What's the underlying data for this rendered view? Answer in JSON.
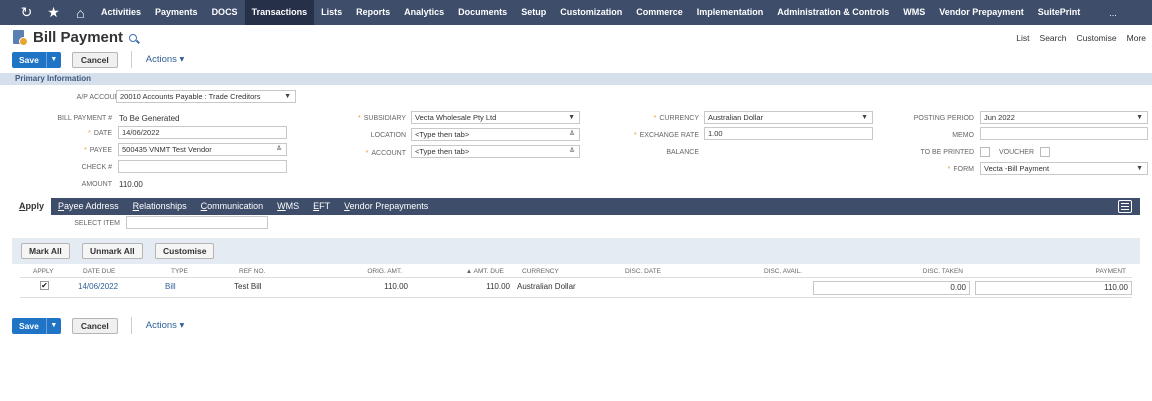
{
  "nav": {
    "items": [
      "Activities",
      "Payments",
      "DOCS",
      "Transactions",
      "Lists",
      "Reports",
      "Analytics",
      "Documents",
      "Setup",
      "Customization",
      "Commerce",
      "Implementation",
      "Administration & Controls",
      "WMS",
      "Vendor Prepayment",
      "SuitePrint"
    ],
    "active": "Transactions",
    "more": "..."
  },
  "header": {
    "title": "Bill Payment",
    "links": [
      "List",
      "Search",
      "Customise",
      "More"
    ]
  },
  "toolbar": {
    "save_label": "Save",
    "arrow": "▼",
    "cancel_label": "Cancel",
    "actions_label": "Actions ▾"
  },
  "section": {
    "title": "Primary Information"
  },
  "form": {
    "ap_account_label": "A/P ACCOUNT",
    "ap_account_value": "20010 Accounts Payable : Trade Creditors",
    "bill_payment_no_label": "BILL PAYMENT #",
    "bill_payment_no_value": "To Be Generated",
    "date_label": "DATE",
    "date_value": "14/06/2022",
    "payee_label": "PAYEE",
    "payee_value": "500435 VNMT Test Vendor",
    "check_label": "CHECK #",
    "amount_label": "AMOUNT",
    "amount_value": "110.00",
    "subsidiary_label": "SUBSIDIARY",
    "subsidiary_value": "Vecta Wholesale Pty Ltd",
    "location_label": "LOCATION",
    "location_value": "<Type then tab>",
    "account_label": "ACCOUNT",
    "account_value": "<Type then tab>",
    "currency_label": "CURRENCY",
    "currency_value": "Australian Dollar",
    "exchange_rate_label": "EXCHANGE RATE",
    "exchange_rate_value": "1.00",
    "balance_label": "BALANCE",
    "posting_period_label": "POSTING PERIOD",
    "posting_period_value": "Jun 2022",
    "memo_label": "MEMO",
    "to_be_printed_label": "TO BE PRINTED",
    "voucher_label": "VOUCHER",
    "form_label": "FORM",
    "form_value": "Vecta -Bill Payment",
    "required_mark": "*"
  },
  "subtabs": [
    {
      "hotkey": "A",
      "rest": "pply"
    },
    {
      "hotkey": "P",
      "rest": "ayee Address"
    },
    {
      "hotkey": "R",
      "rest": "elationships"
    },
    {
      "hotkey": "C",
      "rest": "ommunication"
    },
    {
      "hotkey": "W",
      "rest": "MS"
    },
    {
      "hotkey": "E",
      "rest": "FT"
    },
    {
      "hotkey": "V",
      "rest": "endor Prepayments"
    }
  ],
  "apply": {
    "select_item_label": "SELECT ITEM",
    "mark_all": "Mark All",
    "unmark_all": "Unmark All",
    "customise": "Customise",
    "columns": [
      "APPLY",
      "DATE DUE",
      "TYPE",
      "REF NO.",
      "ORIG. AMT.",
      "▲ AMT. DUE",
      "CURRENCY",
      "DISC. DATE",
      "DISC. AVAIL.",
      "DISC. TAKEN",
      "PAYMENT"
    ],
    "rows": [
      {
        "apply": "✔",
        "date_due": "14/06/2022",
        "type": "Bill",
        "ref_no": "Test Bill",
        "orig_amt": "110.00",
        "amt_due": "110.00",
        "currency": "Australian Dollar",
        "disc_date": "",
        "disc_avail": "",
        "disc_taken": "0.00",
        "payment": "110.00"
      }
    ]
  },
  "colors": {
    "nav": "#3d4d6a",
    "nav_active": "#263149",
    "primary": "#1f74c6",
    "section": "#d6e0ec",
    "required": "#e0a030",
    "link": "#2e5f9a"
  }
}
